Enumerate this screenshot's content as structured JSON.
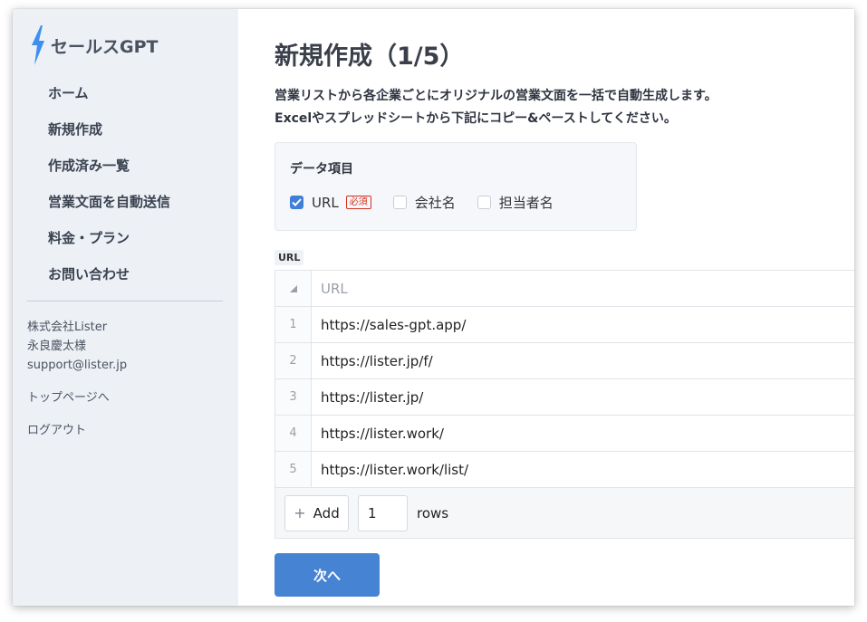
{
  "sidebar": {
    "logo_text": "セールスGPT",
    "items": [
      {
        "label": "ホーム"
      },
      {
        "label": "新規作成"
      },
      {
        "label": "作成済み一覧"
      },
      {
        "label": "営業文面を自動送信"
      },
      {
        "label": "料金・プラン"
      },
      {
        "label": "お問い合わせ"
      }
    ],
    "account": {
      "company": "株式会社Lister",
      "name": "永良慶太様",
      "email": "support@lister.jp"
    },
    "top_page_link": "トップページへ",
    "logout_link": "ログアウト"
  },
  "main": {
    "title": "新規作成（1/5）",
    "description_line1": "営業リストから各企業ごとにオリジナルの営業文面を一括で自動生成します。",
    "description_line2": "Excelやスプレッドシートから下記にコピー&ペーストしてください。",
    "data_fields": {
      "title": "データ項目",
      "options": [
        {
          "label": "URL",
          "checked": true,
          "badge": "必須"
        },
        {
          "label": "会社名",
          "checked": false
        },
        {
          "label": "担当者名",
          "checked": false
        }
      ]
    },
    "column_tag": "URL",
    "grid": {
      "corner_icon": "sort-triangle-icon",
      "header": "URL",
      "rows": [
        {
          "index": "1",
          "url": "https://sales-gpt.app/"
        },
        {
          "index": "2",
          "url": "https://lister.jp/f/"
        },
        {
          "index": "3",
          "url": "https://lister.jp/"
        },
        {
          "index": "4",
          "url": "https://lister.work/"
        },
        {
          "index": "5",
          "url": "https://lister.work/list/"
        }
      ],
      "add_button_label": "Add",
      "rows_value": "1",
      "rows_label": "rows"
    },
    "next_button": "次へ"
  },
  "colors": {
    "sidebar_bg": "#edf1f6",
    "accent": "#4783d3",
    "logo_bolt": "#3f8ff0",
    "required": "#d6321e"
  }
}
